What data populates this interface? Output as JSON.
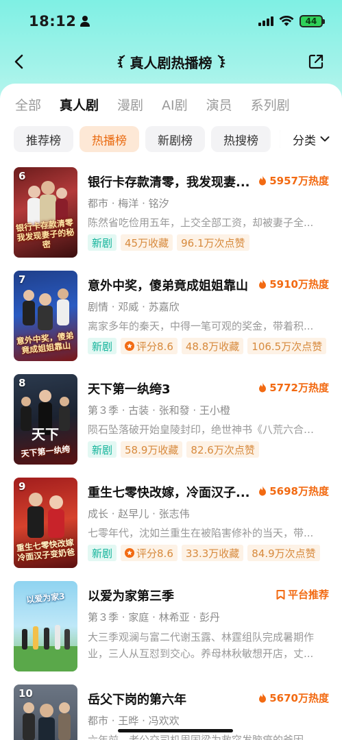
{
  "status_bar": {
    "time": "18:12",
    "battery": "44"
  },
  "header": {
    "title": "真人剧热播榜"
  },
  "category_tabs": [
    {
      "label": "全部",
      "active": false
    },
    {
      "label": "真人剧",
      "active": true
    },
    {
      "label": "漫剧",
      "active": false
    },
    {
      "label": "AI剧",
      "active": false
    },
    {
      "label": "演员",
      "active": false
    },
    {
      "label": "系列剧",
      "active": false
    }
  ],
  "rank_tabs": [
    {
      "label": "推荐榜",
      "active": false
    },
    {
      "label": "热播榜",
      "active": true
    },
    {
      "label": "新剧榜",
      "active": false
    },
    {
      "label": "热搜榜",
      "active": false
    }
  ],
  "filter_label": "分类",
  "items": [
    {
      "rank": "6",
      "title": "银行卡存款清零，我发现妻...",
      "heat": "5957万热度",
      "meta": "都市 · 梅洋 · 铭汐",
      "desc": "陈然省吃俭用五年，上交全部工资，却被妻子全...",
      "poster_caption": "银行卡存款清零 我发现妻子的秘密",
      "tags": [
        "新剧",
        "45万收藏",
        "96.1万次点赞"
      ]
    },
    {
      "rank": "7",
      "title": "意外中奖，傻弟竟成姐姐靠山",
      "heat": "5910万热度",
      "meta": "剧情 · 邓威 · 苏嘉欣",
      "desc": "离家多年的秦天，中得一笔可观的奖金，带着积...",
      "poster_caption": "意外中奖，傻弟竟成姐姐靠山",
      "score": "评分8.6",
      "tags": [
        "新剧",
        "48.8万收藏",
        "106.5万次点赞"
      ]
    },
    {
      "rank": "8",
      "title": "天下第一纨绔3",
      "heat": "5772万热度",
      "meta": "第３季 · 古装 · 张和發 · 王小橙",
      "desc": "陨石坠落破开始皇陵封印，绝世神书《八荒六合》...",
      "poster_caption": "天下第一纨绔",
      "tags": [
        "新剧",
        "58.9万收藏",
        "82.6万次点赞"
      ]
    },
    {
      "rank": "9",
      "title": "重生七零快改嫁，冷面汉子...",
      "heat": "5698万热度",
      "meta": "成长 · 赵早儿 · 张志伟",
      "desc": "七零年代，沈如兰重生在被陷害修补的当天，带...",
      "poster_caption": "重生七零快改嫁 冷面汉子变奶爸",
      "score": "评分8.6",
      "tags": [
        "新剧",
        "33.3万收藏",
        "84.9万次点赞"
      ]
    },
    {
      "rank": "",
      "title": "以爱为家第三季",
      "heat": "平台推荐",
      "meta": "第３季 · 家庭 · 林希亚 · 彭丹",
      "desc": "大三季观澜与富二代谢玉露、林霆组队完成暑期作业，三人从互怼到交心。养母林秋敏想开店，丈...",
      "poster_caption": "以爱为家3"
    },
    {
      "rank": "10",
      "title": "岳父下岗的第六年",
      "heat": "5670万热度",
      "meta": "都市 · 王晔 · 冯欢欢",
      "desc": "六年前，老公交司机周国梁为救突发脑癌的爸因..."
    }
  ],
  "colors": {
    "accent": "#f26a12",
    "teal": "#12b39a",
    "header_bg": "#7ff0e4"
  }
}
